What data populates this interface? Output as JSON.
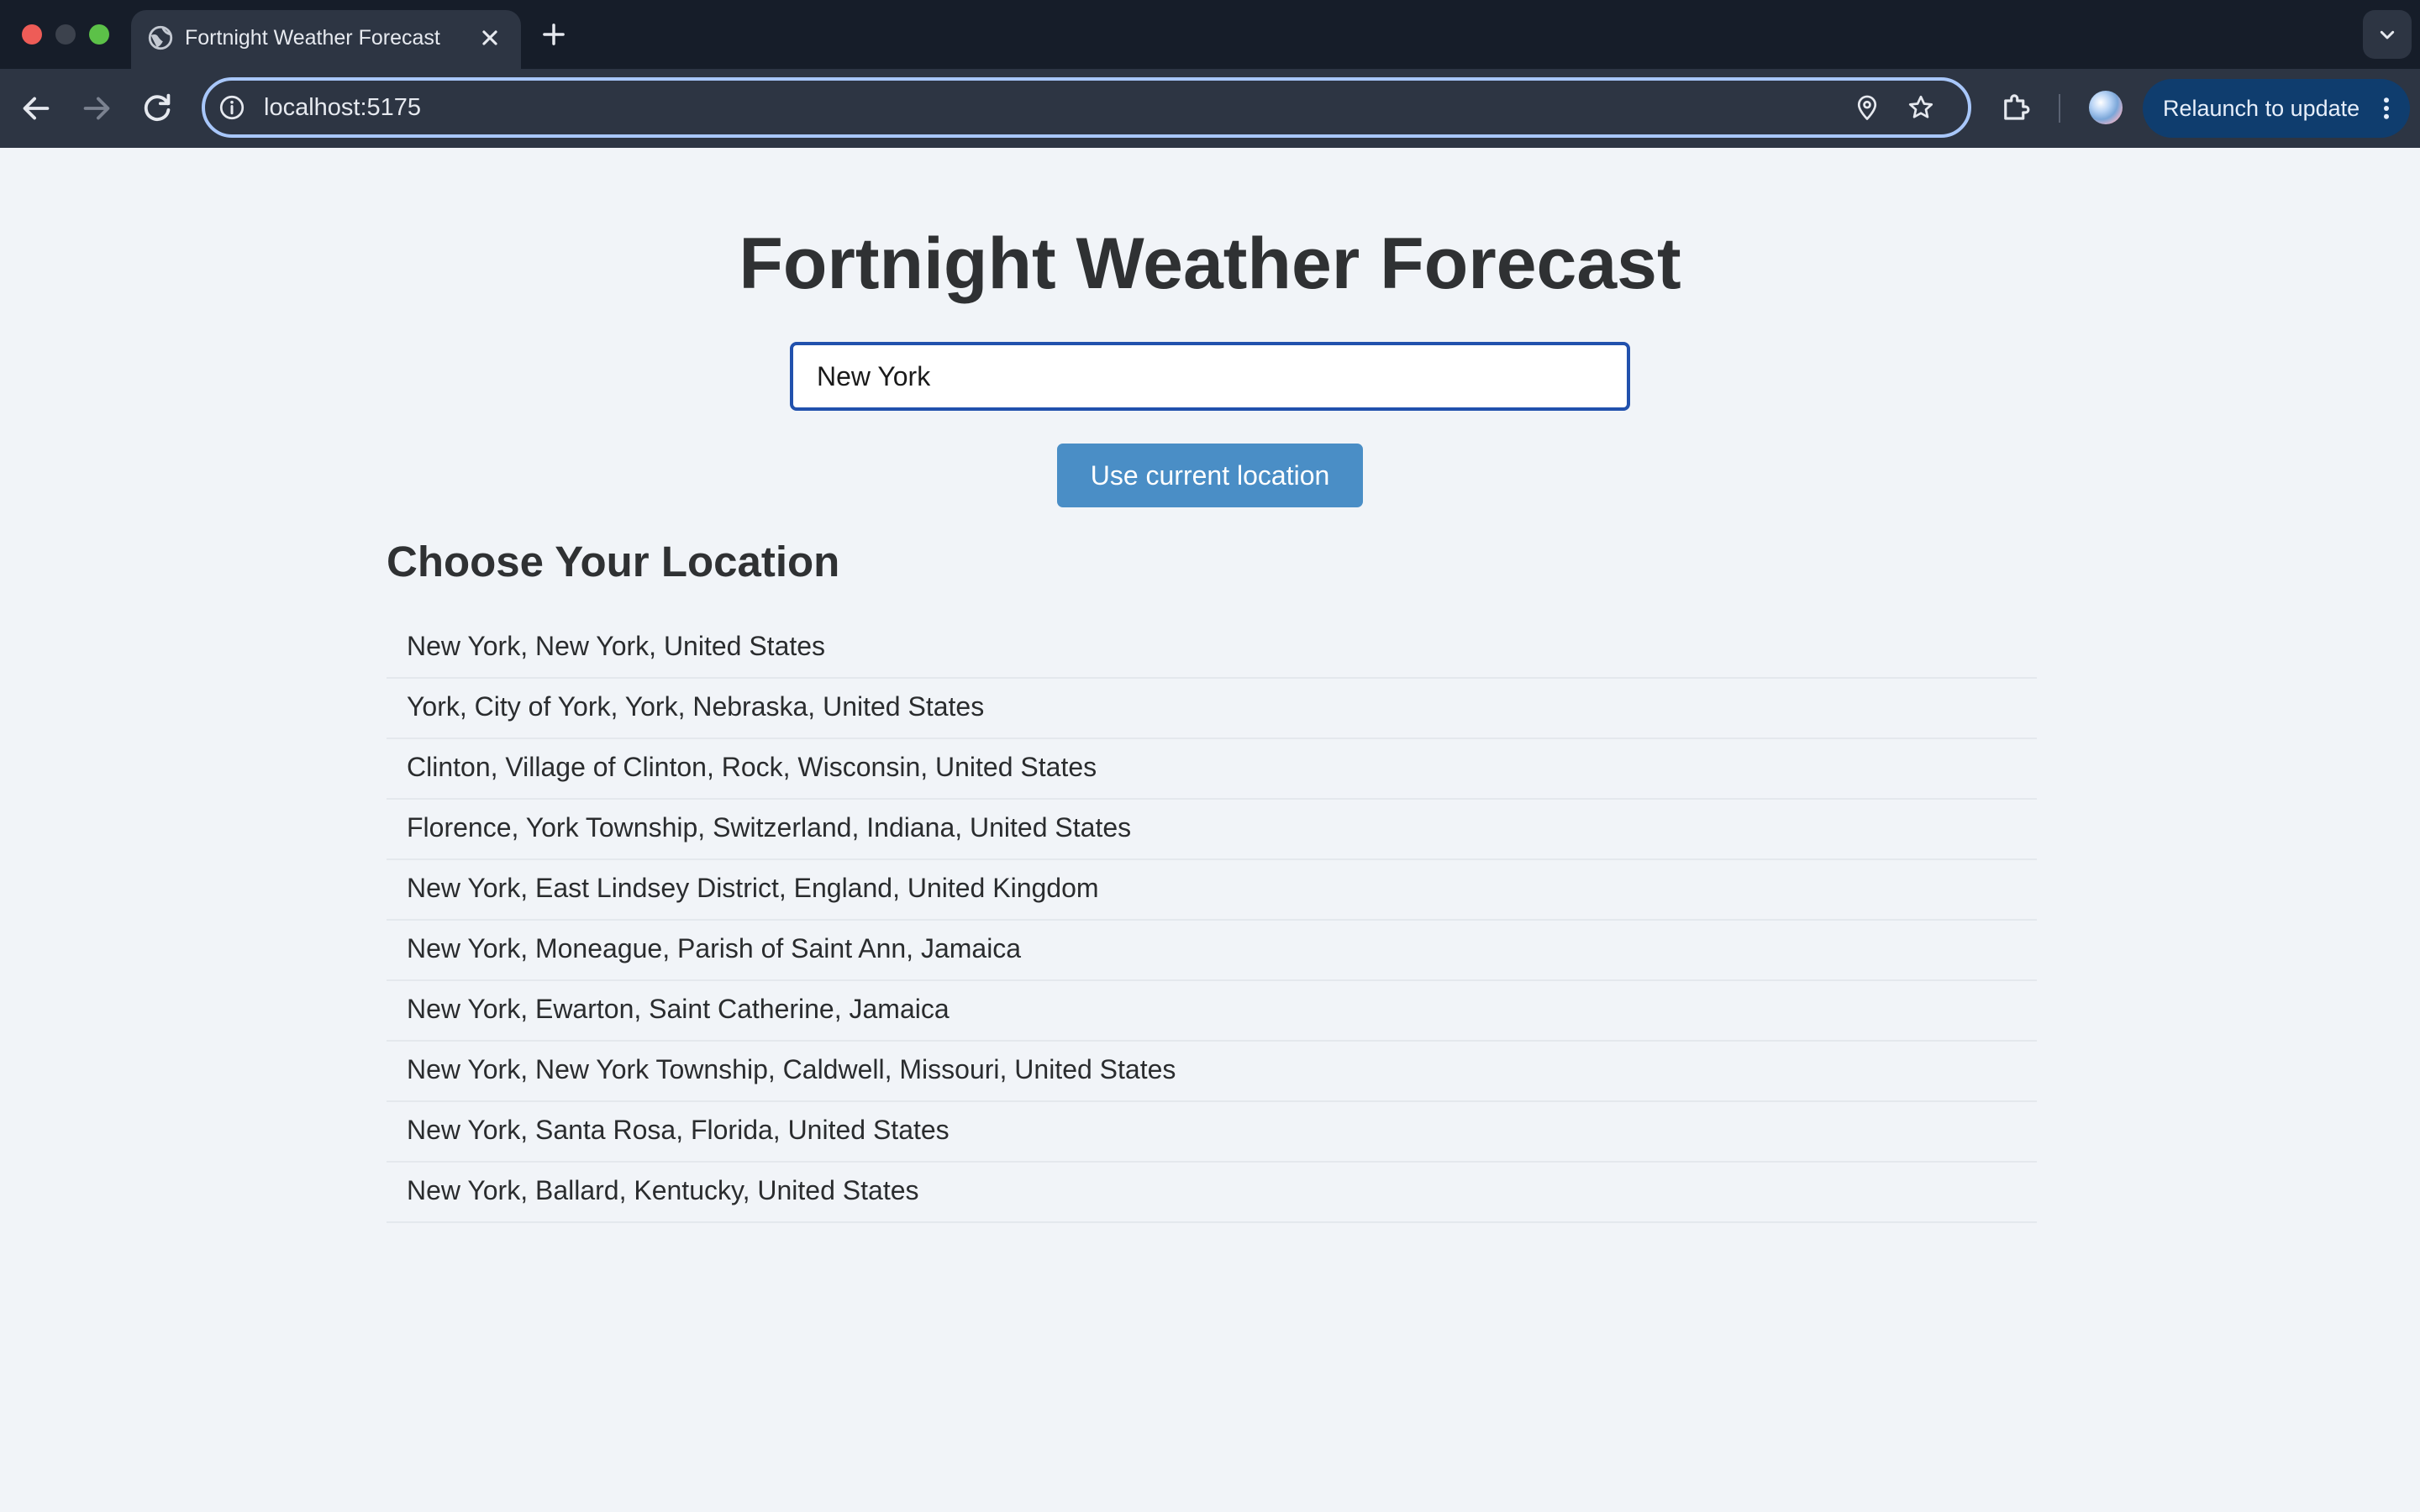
{
  "browser": {
    "tab_title": "Fortnight Weather Forecast",
    "url": "localhost:5175",
    "relaunch_label": "Relaunch to update"
  },
  "page": {
    "title": "Fortnight Weather Forecast",
    "search": {
      "value": "New York"
    },
    "geo_button_label": "Use current location",
    "section_heading": "Choose Your Location",
    "locations": [
      "New York, New York, United States",
      "York, City of York, York, Nebraska, United States",
      "Clinton, Village of Clinton, Rock, Wisconsin, United States",
      "Florence, York Township, Switzerland, Indiana, United States",
      "New York, East Lindsey District, England, United Kingdom",
      "New York, Moneague, Parish of Saint Ann, Jamaica",
      "New York, Ewarton, Saint Catherine, Jamaica",
      "New York, New York Township, Caldwell, Missouri, United States",
      "New York, Santa Rosa, Florida, United States",
      "New York, Ballard, Kentucky, United States"
    ]
  },
  "colors": {
    "chrome_bg": "#161d29",
    "toolbar_bg": "#2d3543",
    "page_bg": "#f1f4f8",
    "input_border": "#2151ad",
    "button_bg": "#4a8ec6",
    "relaunch_bg": "#0f3d6e"
  },
  "icons": [
    "globe-icon",
    "close-icon",
    "plus-icon",
    "chevron-down-icon",
    "back-arrow-icon",
    "forward-arrow-icon",
    "reload-icon",
    "info-icon",
    "location-pin-icon",
    "star-icon",
    "puzzle-icon",
    "kebab-menu-icon"
  ]
}
